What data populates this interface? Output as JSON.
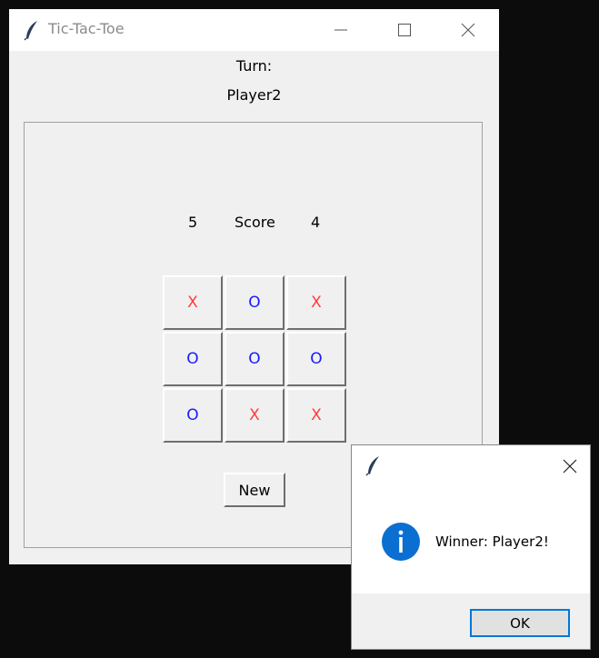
{
  "main_window": {
    "title": "Tic-Tac-Toe",
    "turn_label": "Turn:",
    "turn_player": "Player2",
    "score": {
      "left": "5",
      "label": "Score",
      "right": "4"
    },
    "board": [
      [
        "X",
        "O",
        "X"
      ],
      [
        "O",
        "O",
        "O"
      ],
      [
        "O",
        "X",
        "X"
      ]
    ],
    "new_button_label": "New"
  },
  "dialog": {
    "message": "Winner: Player2!",
    "ok_label": "OK"
  },
  "colors": {
    "x_mark": "#ff3b3b",
    "o_mark": "#1a1aff",
    "info_blue": "#0a6fd1",
    "focus_border": "#0078d7"
  },
  "icons": [
    "feather-icon",
    "minimize-icon",
    "maximize-icon",
    "close-icon",
    "info-icon"
  ]
}
